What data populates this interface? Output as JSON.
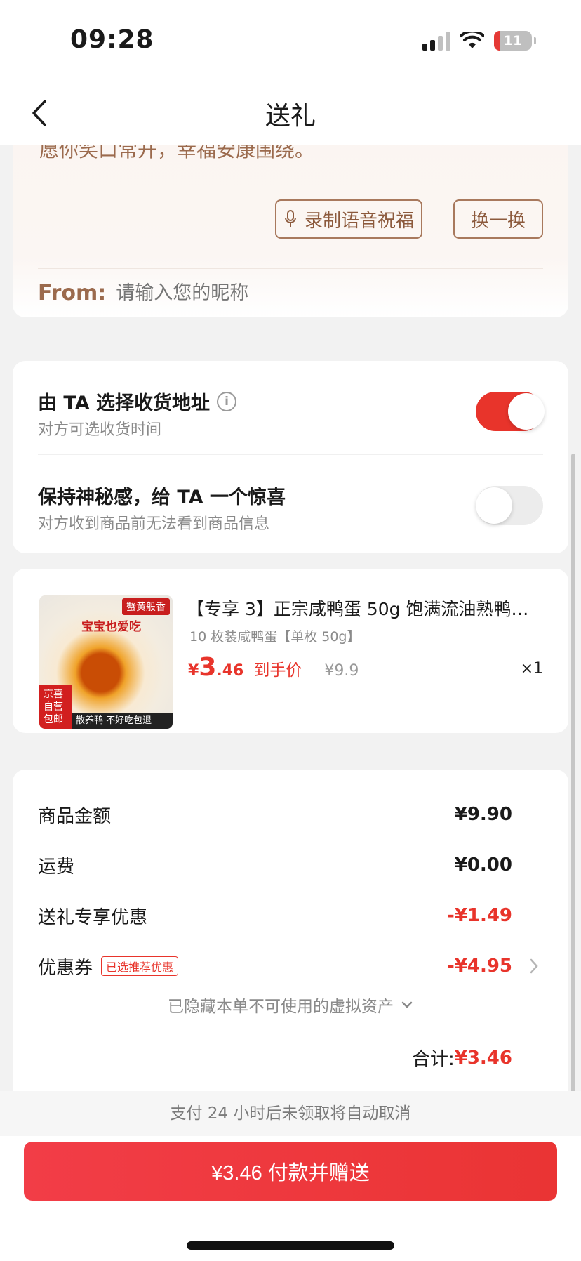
{
  "status_bar": {
    "time": "09:28",
    "battery": "11"
  },
  "nav": {
    "title": "送礼"
  },
  "greeting": {
    "message": "愿你笑口常开，幸福安康围绕。",
    "voice_label": "录制语音祝福",
    "swap_label": "换一换",
    "from_label": "From:",
    "from_placeholder": "请输入您的昵称"
  },
  "options": [
    {
      "title": "由 TA 选择收货地址",
      "subtitle": "对方可选收货时间",
      "enabled": true
    },
    {
      "title": "保持神秘感，给 TA 一个惊喜",
      "subtitle": "对方收到商品前无法看到商品信息",
      "enabled": false
    }
  ],
  "product": {
    "title": "【专享 3】正宗咸鸭蛋 50g 饱满流油熟鸭…",
    "spec": "10 枚装咸鸭蛋【单枚 50g】",
    "price_symbol": "¥",
    "price_int": "3",
    "price_dec": ".46",
    "price_label": "到手价",
    "original_price": "¥9.9",
    "quantity": "×1",
    "image_tag": "蟹黄般香",
    "image_slogan": "宝宝也爱吃",
    "image_badge": "京喜自营 包邮",
    "image_footer": "散养鸭 不好吃包退"
  },
  "summary": {
    "rows": [
      {
        "label": "商品金额",
        "value": "¥9.90"
      },
      {
        "label": "运费",
        "value": "¥0.00"
      },
      {
        "label": "送礼专享优惠",
        "value": "-¥1.49"
      },
      {
        "label": "优惠券",
        "tag": "已选推荐优惠",
        "value": "-¥4.95"
      }
    ],
    "hidden_assets": "已隐藏本单不可使用的虚拟资产",
    "total_label": "合计:",
    "total_value": "¥3.46"
  },
  "bottom": {
    "notice": "支付 24 小时后未领取将自动取消",
    "pay_label": "¥3.46 付款并赠送"
  },
  "colors": {
    "accent": "#e8342b",
    "brown": "#9b6a4d",
    "toggle_on": "#e8342b"
  }
}
